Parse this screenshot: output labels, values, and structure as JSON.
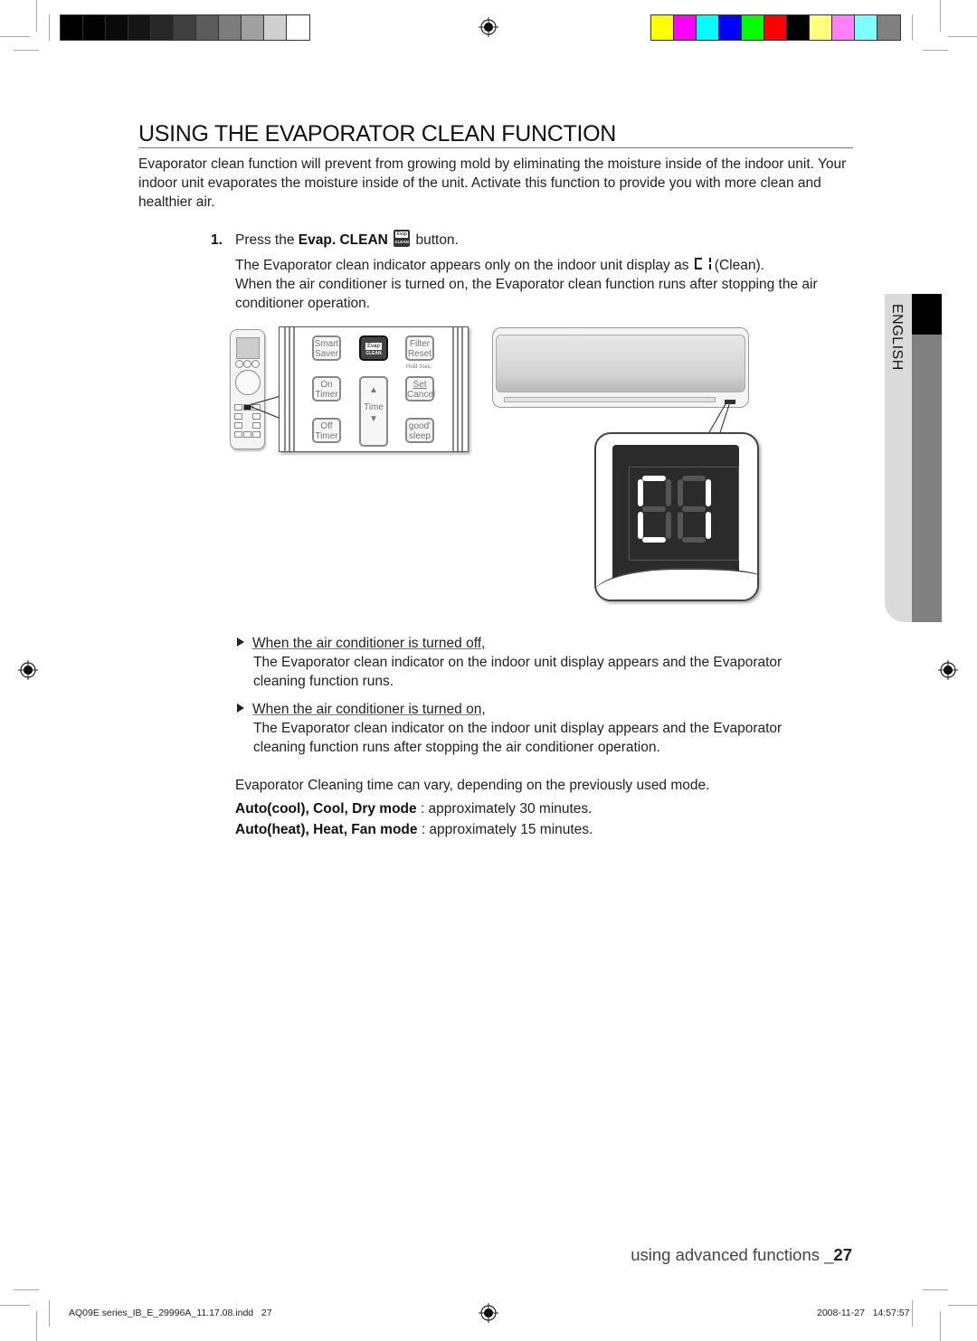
{
  "print_marks": {
    "gray_swatches": [
      "#000000",
      "#030303",
      "#0a0a0a",
      "#161616",
      "#272727",
      "#404040",
      "#5c5c5c",
      "#7c7c7c",
      "#a0a0a0",
      "#cfcfcf",
      "#ffffff"
    ],
    "color_swatches": [
      "#ffff00",
      "#ff00ff",
      "#00ffff",
      "#0000ff",
      "#00ff00",
      "#ff0000",
      "#000000",
      "#ffff80",
      "#ff80ff",
      "#80ffff",
      "#808080"
    ]
  },
  "page": {
    "title": "USING THE EVAPORATOR CLEAN FUNCTION",
    "intro": "Evaporator clean function will prevent from growing mold by eliminating the moisture inside of the indoor unit. Your indoor unit evaporates the moisture inside of the unit. Activate this function to provide you with more clean and healthier air.",
    "step": {
      "number": "1.",
      "prefix": "Press the ",
      "button_name": "Evap. CLEAN",
      "suffix": " button.",
      "icon_top": "Evap",
      "icon_bottom": "CLEAN"
    },
    "indicator_line_1": "The Evaporator clean indicator appears only on the indoor unit display as ",
    "indicator_symbol_label": "(Clean).",
    "indicator_line_2": "When the air conditioner is turned on, the Evaporator clean function runs after stopping the air conditioner operation.",
    "notes": [
      {
        "heading": "When the air conditioner is turned off,",
        "body": "The Evaporator clean indicator on the indoor unit display appears and the Evaporator cleaning function runs."
      },
      {
        "heading": "When the air conditioner is turned on,",
        "body": "The Evaporator clean indicator on the indoor unit display appears and the Evaporator cleaning function runs after stopping the air conditioner operation."
      }
    ],
    "time_note": "Evaporator Cleaning time can vary, depending on the previously used mode.",
    "modes": [
      {
        "modes": "Auto(cool), Cool, Dry mode",
        "time": " : approximately 30 minutes."
      },
      {
        "modes": "Auto(heat), Heat, Fan mode",
        "time": " : approximately 15 minutes."
      }
    ]
  },
  "illustration": {
    "remote_buttons": {
      "smart_saver": [
        "Smart",
        "Saver"
      ],
      "evap_clean": [
        "Evap",
        "CLEAN"
      ],
      "filter_reset": [
        "Filter",
        "Reset"
      ],
      "hold_note": "Hold 3sec.",
      "on_timer": [
        "On",
        "Timer"
      ],
      "time": "Time",
      "set_cancel": [
        "Set",
        "Cancel"
      ],
      "off_timer": [
        "Off",
        "Timer"
      ],
      "good_sleep": [
        "good'",
        "sleep"
      ]
    },
    "display_readout": "CL"
  },
  "side_tab": {
    "language": "ENGLISH"
  },
  "footer": {
    "section": "using advanced functions _",
    "page_number": "27",
    "slug_file": "AQ09E series_IB_E_29996A_11.17.08.indd   27",
    "slug_date": "2008-11-27   14:57:57"
  }
}
